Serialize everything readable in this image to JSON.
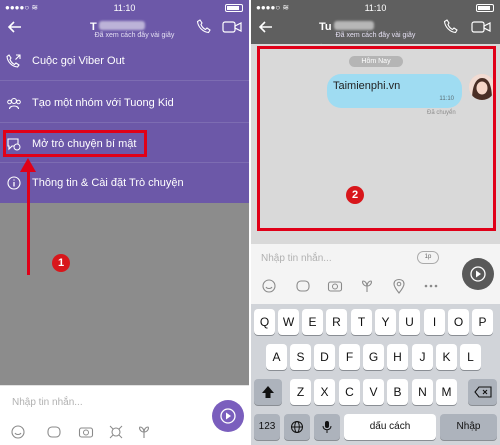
{
  "status": {
    "time_left": "11:10",
    "time_right": "11:10"
  },
  "left": {
    "header": {
      "title": "T",
      "subtitle": "Đã xem cách đây vài giây"
    },
    "menu": [
      {
        "label": "Cuộc gọi Viber Out",
        "icon": "phone-out-icon"
      },
      {
        "label": "Tạo một nhóm với Tuong Kid",
        "icon": "group-icon"
      },
      {
        "label": "Mở trò chuyện bí mật",
        "icon": "secret-chat-icon"
      },
      {
        "label": "Thông tin & Cài đặt Trò chuyện",
        "icon": "info-icon"
      }
    ],
    "badge": "1",
    "composer": {
      "placeholder": "Nhập tin nhắn..."
    }
  },
  "right": {
    "header": {
      "title": "Tu",
      "subtitle": "Đã xem cách đây vài giây"
    },
    "date_pill": "Hôm Nay",
    "message": {
      "text": "Taimienphi.vn",
      "time": "11:10",
      "status": "Đã chuyển"
    },
    "badge": "2",
    "composer": {
      "placeholder": "Nhập tin nhắn...",
      "timer": "1p"
    },
    "keyboard": {
      "row1": [
        "Q",
        "W",
        "E",
        "R",
        "T",
        "Y",
        "U",
        "I",
        "O",
        "P"
      ],
      "row2": [
        "A",
        "S",
        "D",
        "F",
        "G",
        "H",
        "J",
        "K",
        "L"
      ],
      "row3": [
        "Z",
        "X",
        "C",
        "V",
        "B",
        "N",
        "M"
      ],
      "num": "123",
      "space": "dấu cách",
      "enter": "Nhập"
    }
  },
  "colors": {
    "viber_purple": "#6c58a8",
    "annotation_red": "#e00018"
  }
}
